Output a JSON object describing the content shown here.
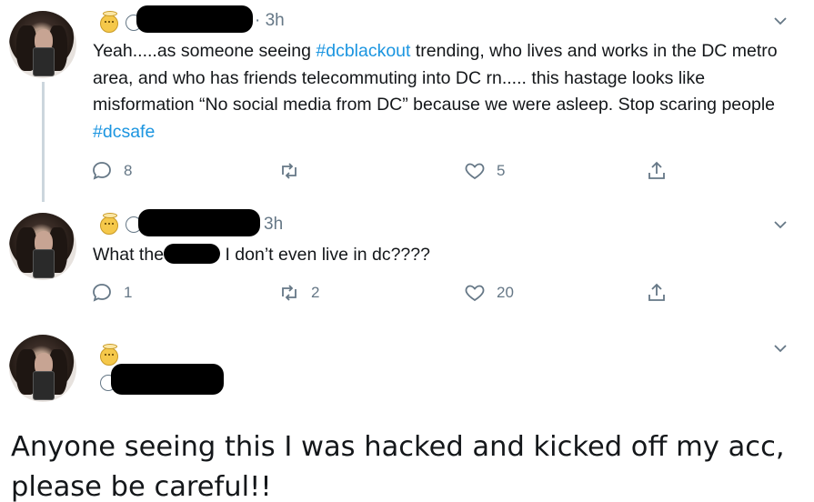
{
  "tweets": [
    {
      "time": "· 3h",
      "text_parts": {
        "a": "Yeah.....as someone seeing ",
        "tag1": "#dcblackout",
        "b": " trending, who lives and works in the DC metro area, and who has friends telecommuting into DC rn..... this hastage looks like misformation “No social media from DC” because we were asleep. Stop scaring people ",
        "tag2": "#dcsafe"
      },
      "replies": "8",
      "retweets": "",
      "likes": "5"
    },
    {
      "time": "3h",
      "text_before": "What the",
      "text_after": " I don’t even live in dc????",
      "replies": "1",
      "retweets": "2",
      "likes": "20"
    },
    {
      "text": "Anyone seeing this I was hacked and kicked off my acc, please be careful!!"
    }
  ],
  "icons": {
    "reply": "reply-icon",
    "retweet": "retweet-icon",
    "like": "heart-icon",
    "share": "share-icon",
    "more": "chevron-down-icon",
    "badge": "angel-emoji"
  },
  "colors": {
    "hashtag": "#1b95e0",
    "muted": "#657786",
    "text": "#14171a",
    "thread_line": "#ccd6dd"
  }
}
